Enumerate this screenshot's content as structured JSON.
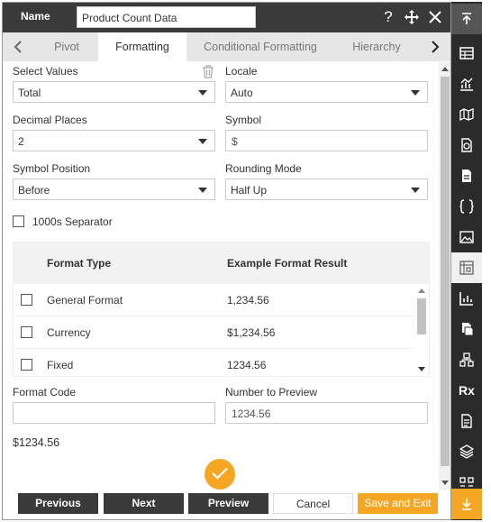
{
  "header": {
    "name_label": "Name",
    "name_value": "Product Count Data",
    "icons": [
      "help-icon",
      "move-icon",
      "close-icon"
    ]
  },
  "tabs": {
    "items": [
      {
        "label": "Pivot",
        "active": false
      },
      {
        "label": "Formatting",
        "active": true
      },
      {
        "label": "Conditional Formatting",
        "active": false
      },
      {
        "label": "Hierarchy",
        "active": false
      }
    ]
  },
  "form": {
    "select_values": {
      "label": "Select Values",
      "value": "Total"
    },
    "locale": {
      "label": "Locale",
      "value": "Auto"
    },
    "decimal_places": {
      "label": "Decimal Places",
      "value": "2"
    },
    "symbol": {
      "label": "Symbol",
      "value": "$"
    },
    "symbol_position": {
      "label": "Symbol Position",
      "value": "Before"
    },
    "rounding_mode": {
      "label": "Rounding Mode",
      "value": "Half Up"
    },
    "separator": {
      "label": "1000s Separator",
      "checked": false
    },
    "format_code": {
      "label": "Format Code",
      "value": ""
    },
    "number_preview": {
      "label": "Number to Preview",
      "value": "1234.56"
    },
    "result": "$1234.56"
  },
  "format_table": {
    "headers": [
      "Format Type",
      "Example Format Result"
    ],
    "rows": [
      {
        "type": "General Format",
        "example": "1,234.56",
        "checked": false
      },
      {
        "type": "Currency",
        "example": "$1,234.56",
        "checked": false
      },
      {
        "type": "Fixed",
        "example": "1234.56",
        "checked": false
      }
    ]
  },
  "footer": {
    "previous": "Previous",
    "next": "Next",
    "preview": "Preview",
    "cancel": "Cancel",
    "save_exit": "Save and Exit"
  },
  "sidebar": {
    "items": [
      "collapse-top-icon",
      "table-icon",
      "chart-icon",
      "map-icon",
      "report-icon",
      "document-icon",
      "braces-icon",
      "image-icon",
      "pivot-icon",
      "bar-chart-icon",
      "copy-icon",
      "hierarchy-icon",
      "rx-icon",
      "sheet-icon",
      "layers-icon",
      "grid-icon",
      "expand-bottom-icon"
    ],
    "rx_label": "Rx"
  },
  "colors": {
    "header_bg": "#3a3a3a",
    "accent": "#f5a623",
    "sidebar_bg": "#2b2b2b"
  }
}
